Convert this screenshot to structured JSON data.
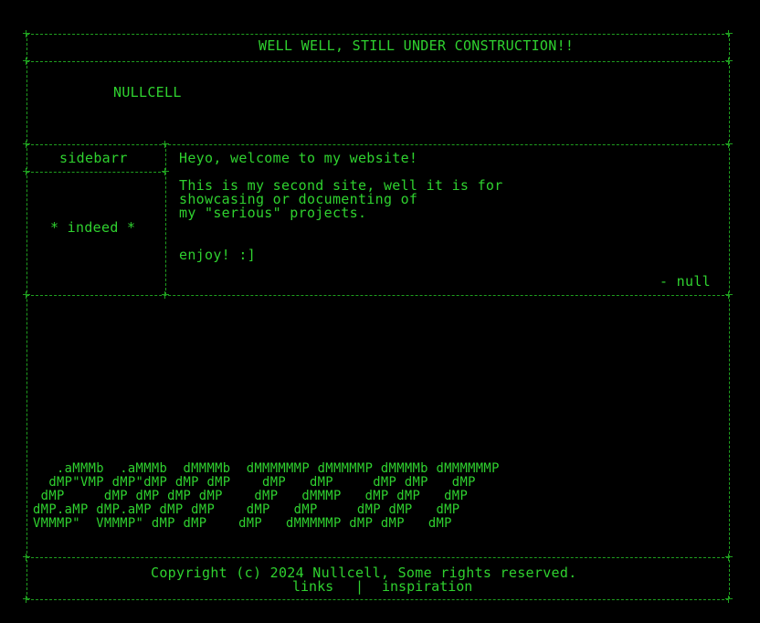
{
  "banner": {
    "title": "WELL WELL, STILL UNDER CONSTRUCTION!!"
  },
  "brand": {
    "name": "NULLCELL"
  },
  "sidebar": {
    "title": "sidebarr",
    "note": "* indeed *"
  },
  "main": {
    "welcome": "Heyo, welcome to my website!",
    "intro": "This is my second site, well it is for\nshowcasing or documenting of\nmy \"serious\" projects.",
    "enjoy": "enjoy! :]",
    "signoff": "- null"
  },
  "ascii_art": {
    "logo": "   .aMMMb  .aMMMb  dMMMMb  dMMMMMMP dMMMMMP dMMMMb dMMMMMMP\n  dMP\"VMP dMP\"dMP dMP dMP    dMP   dMP     dMP dMP   dMP\n dMP     dMP dMP dMP dMP    dMP   dMMMP   dMP dMP   dMP\ndMP.aMP dMP.aMP dMP dMP    dMP   dMP     dMP dMP   dMP\nVMMMP\"  VMMMP\" dMP dMP    dMP   dMMMMMP dMP dMP   dMP"
  },
  "footer": {
    "copyright": "Copyright (c) 2024 Nullcell, Some rights reserved.",
    "links_label": "links",
    "separator": "|",
    "inspiration_label": "inspiration"
  },
  "colors": {
    "background": "#000000",
    "text": "#2fd12f",
    "border": "#1f9f1f"
  }
}
